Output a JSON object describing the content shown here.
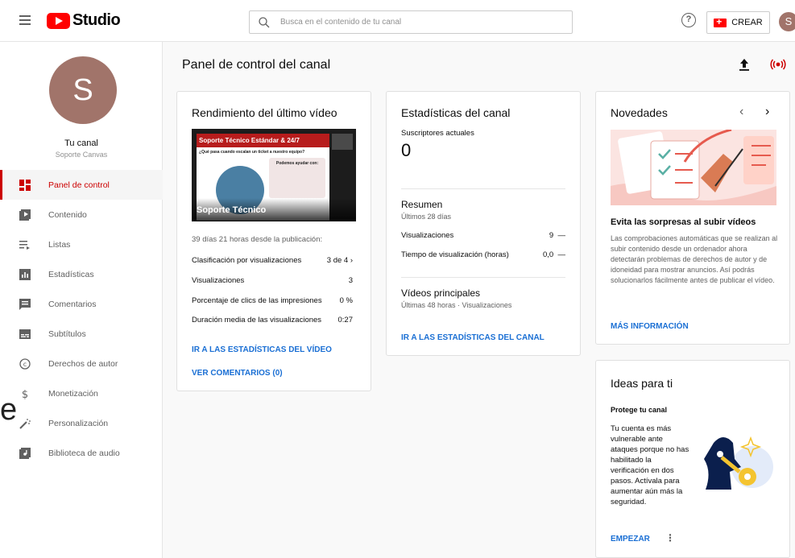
{
  "header": {
    "logo_text": "Studio",
    "search_placeholder": "Busca en el contenido de tu canal",
    "help_label": "?",
    "create_label": "CREAR",
    "avatar_letter": "S"
  },
  "sidebar": {
    "avatar_letter": "S",
    "channel_label": "Tu canal",
    "channel_name": "Soporte Canvas",
    "items": [
      {
        "label": "Panel de control",
        "icon": "dashboard-icon"
      },
      {
        "label": "Contenido",
        "icon": "content-icon"
      },
      {
        "label": "Listas",
        "icon": "playlist-icon"
      },
      {
        "label": "Estadísticas",
        "icon": "analytics-icon"
      },
      {
        "label": "Comentarios",
        "icon": "comments-icon"
      },
      {
        "label": "Subtítulos",
        "icon": "subtitles-icon"
      },
      {
        "label": "Derechos de autor",
        "icon": "copyright-icon"
      },
      {
        "label": "Monetización",
        "icon": "monetization-icon"
      },
      {
        "label": "Personalización",
        "icon": "customization-icon"
      },
      {
        "label": "Biblioteca de audio",
        "icon": "audio-library-icon"
      }
    ],
    "stray_char": "e"
  },
  "main": {
    "title": "Panel de control del canal"
  },
  "latest_video": {
    "title": "Rendimiento del último vídeo",
    "thumb_slide_title": "Soporte Técnico Estándar & 24/7",
    "thumb_question": "¿Qué pasa cuando escalan un ticket a nuestro equipo?",
    "thumb_box_title": "Podemos ayudar con:",
    "thumb_caption": "Soporte Técnico",
    "published": "39 días 21 horas desde la publicación:",
    "rank_label": "Clasificación por visualizaciones",
    "rank_value": "3 de 4",
    "views_label": "Visualizaciones",
    "views_value": "3",
    "ctr_label": "Porcentaje de clics de las impresiones",
    "ctr_value": "0 %",
    "avg_label": "Duración media de las visualizaciones",
    "avg_value": "0:27",
    "link_stats": "IR A LAS ESTADÍSTICAS DEL VÍDEO",
    "link_comments": "VER COMENTARIOS (0)"
  },
  "channel_stats": {
    "title": "Estadísticas del canal",
    "subs_label": "Suscriptores actuales",
    "subs_value": "0",
    "summary_title": "Resumen",
    "summary_period": "Últimos 28 días",
    "views_label": "Visualizaciones",
    "views_value": "9",
    "views_delta": "—",
    "watch_label": "Tiempo de visualización (horas)",
    "watch_value": "0,0",
    "watch_delta": "—",
    "top_title": "Vídeos principales",
    "top_sub": "Últimas 48 horas · Visualizaciones",
    "link": "IR A LAS ESTADÍSTICAS DEL CANAL"
  },
  "news": {
    "title": "Novedades",
    "headline": "Evita las sorpresas al subir vídeos",
    "body": "Las comprobaciones automáticas que se realizan al subir contenido desde un ordenador ahora detectarán problemas de derechos de autor y de idoneidad para mostrar anuncios. Así podrás solucionarlos fácilmente antes de publicar el vídeo.",
    "link": "MÁS INFORMACIÓN"
  },
  "ideas": {
    "title": "Ideas para ti",
    "subtitle": "Protege tu canal",
    "body": "Tu cuenta es más vulnerable ante ataques porque no has habilitado la verificación en dos pasos. Actívala para aumentar aún más la seguridad.",
    "link": "EMPEZAR"
  },
  "colors": {
    "accent_red": "#cc0000",
    "link_blue": "#1a6fd4",
    "avatar": "#a1746a"
  }
}
